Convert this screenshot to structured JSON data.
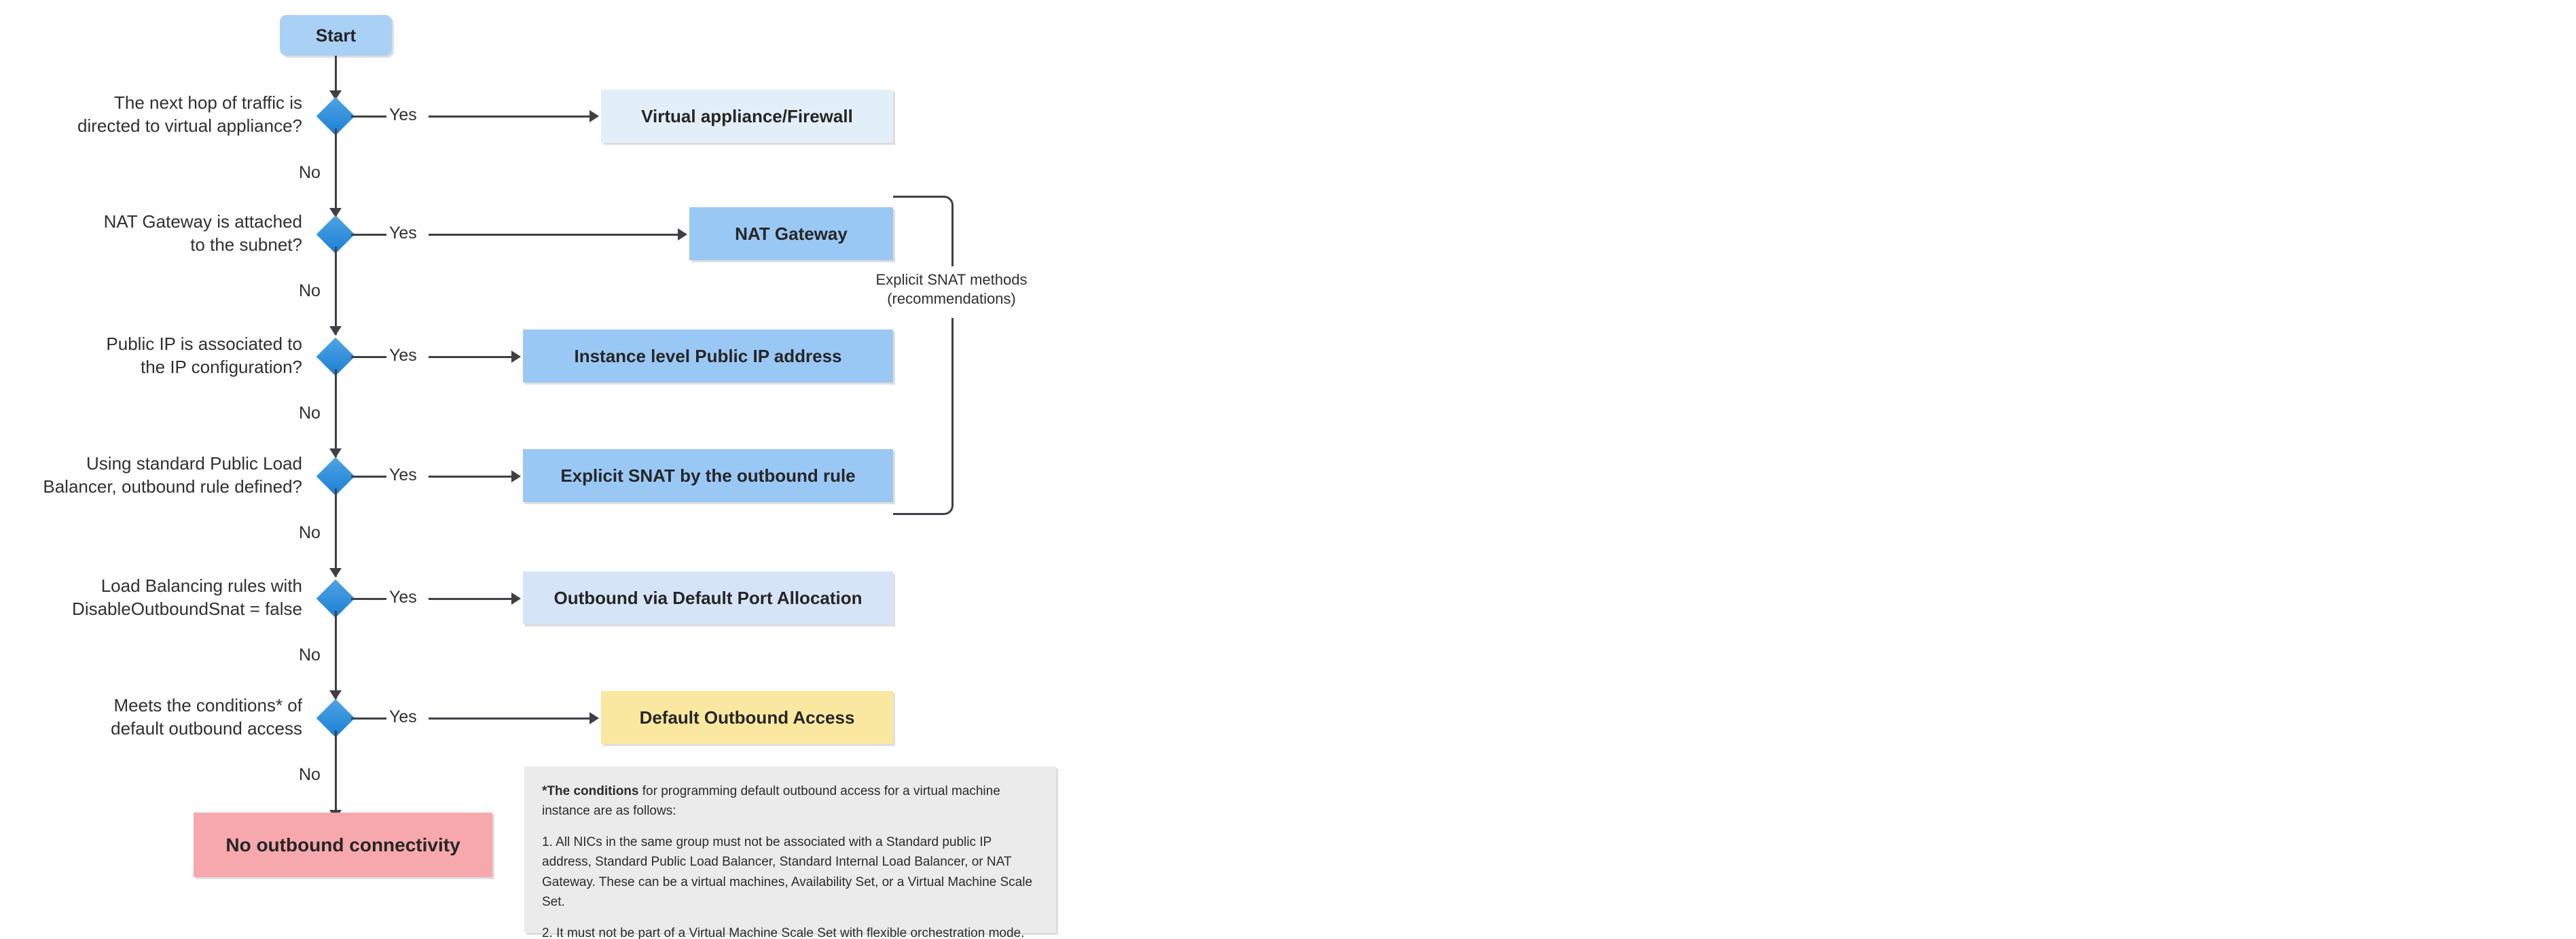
{
  "diagram": {
    "title": "Azure outbound connectivity decision flowchart",
    "colors": {
      "start_fill": "#a9d0f5",
      "process_fill": "#9ac8f5",
      "light_fill": "#e3eff8",
      "light_fill_2": "#d6e4f7",
      "warning_fill": "#fbe8a0",
      "error_fill": "#f7a8ac",
      "decision_fill": "#1b7fd4",
      "line": "#3f3f46",
      "note_fill": "#ebebeb"
    }
  },
  "start": {
    "label": "Start"
  },
  "decisions": [
    {
      "id": "next-hop",
      "question": "The next hop of traffic is\ndirected to virtual appliance?",
      "yes": "Yes",
      "no": "No"
    },
    {
      "id": "nat-gateway",
      "question": "NAT Gateway is attached\nto the subnet?",
      "yes": "Yes",
      "no": "No"
    },
    {
      "id": "public-ip",
      "question": "Public IP is associated to\nthe IP configuration?",
      "yes": "Yes",
      "no": "No"
    },
    {
      "id": "outbound-rule",
      "question": "Using standard Public Load\nBalancer, outbound rule defined?",
      "yes": "Yes",
      "no": "No"
    },
    {
      "id": "disable-outbound-snat",
      "question": "Load Balancing rules with\nDisableOutboundSnat = false",
      "yes": "Yes",
      "no": "No"
    },
    {
      "id": "default-outbound-conditions",
      "question": "Meets the conditions* of\ndefault outbound access",
      "yes": "Yes",
      "no": "No"
    }
  ],
  "outcomes": [
    {
      "id": "virtual-appliance-firewall",
      "label": "Virtual appliance/Firewall"
    },
    {
      "id": "nat-gateway",
      "label": "NAT Gateway"
    },
    {
      "id": "instance-level-public-ip",
      "label": "Instance level Public IP address"
    },
    {
      "id": "explicit-snat-outbound-rule",
      "label": "Explicit SNAT by the outbound rule"
    },
    {
      "id": "outbound-default-port-alloc",
      "label": "Outbound via Default Port Allocation"
    },
    {
      "id": "default-outbound-access",
      "label": "Default Outbound Access"
    },
    {
      "id": "no-outbound-connectivity",
      "label": "No outbound connectivity"
    }
  ],
  "annotation": {
    "explicit_snat": "Explicit SNAT methods\n(recommendations)"
  },
  "note": {
    "intro_bold": "*The conditions",
    "intro_rest": " for programming default outbound access for a virtual machine instance are as follows:",
    "item1": "1. All NICs in the same group must not be associated with a Standard public IP address, Standard Public Load Balancer, Standard Internal Load Balancer, or NAT Gateway. These can be a virtual machines, Availability Set, or a Virtual Machine Scale Set.",
    "item2": "2. It must not be part of a Virtual Machine Scale Set with flexible orchestration mode."
  }
}
